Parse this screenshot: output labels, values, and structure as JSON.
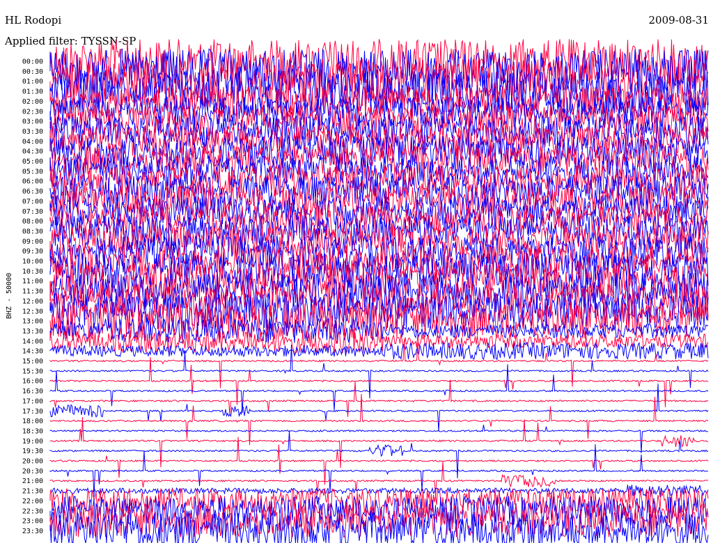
{
  "header": {
    "station": "HL Rodopi",
    "filter": "Applied filter: TYSSN-SP",
    "date": "2009-08-31"
  },
  "chart_data": {
    "type": "line",
    "title": "HL Rodopi",
    "subtitle": "Applied filter: TYSSN-SP",
    "ylabel": "BHZ - 50000",
    "channel_label": "BHZ - 50000",
    "y_ticks": [
      "00:00",
      "00:30",
      "01:00",
      "01:30",
      "02:00",
      "02:30",
      "03:00",
      "03:30",
      "04:00",
      "04:30",
      "05:00",
      "05:30",
      "06:00",
      "06:30",
      "07:00",
      "07:30",
      "08:00",
      "08:30",
      "09:00",
      "09:30",
      "10:00",
      "10:30",
      "11:00",
      "11:30",
      "12:00",
      "12:30",
      "13:00",
      "13:30",
      "14:00",
      "14:30",
      "15:00",
      "15:30",
      "16:00",
      "16:30",
      "17:00",
      "17:30",
      "18:00",
      "18:30",
      "19:00",
      "19:30",
      "20:00",
      "20:30",
      "21:00",
      "21:30",
      "22:00",
      "22:30",
      "23:00",
      "23:30"
    ],
    "y_tick_display": [
      "00:00",
      "00:30",
      "01:00",
      "01:30",
      "02:00",
      "02:30",
      "03:00",
      "03:30",
      "04:00",
      "04:30",
      "05:00",
      "05:30",
      "06:00",
      "06:30",
      "07:00",
      "07:30",
      "08:00",
      "08:30",
      "09:00",
      "09:30",
      "10:00",
      "10:30",
      "11:00",
      "11:30",
      "12:00",
      "12:30",
      "13:00",
      "13:30",
      "14:00",
      "14:30",
      "15:00",
      "15:30",
      "16:00",
      "16:30",
      "17:00",
      "17:30",
      "18:00",
      "18:30",
      "19:00",
      "19:30",
      "20:00",
      "20:30",
      "21:00",
      "21:30",
      "22:00",
      "22:30",
      "23:00",
      "23:30"
    ],
    "trace_colors": [
      "#ff0040",
      "#0000ff"
    ],
    "grid": false
  }
}
